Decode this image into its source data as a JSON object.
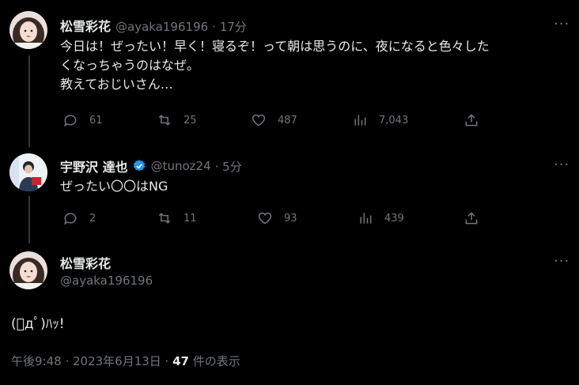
{
  "tweet1": {
    "name": "松雪彩花",
    "handle": "@ayaka196196",
    "time": "· 17分",
    "lines": [
      "今日は！ぜったい！早く！寝るぞ！って朝は思うのに、夜になると色々した",
      "くなっちゃうのはなぜ。",
      "教えておじいさん…"
    ],
    "replies": "61",
    "retweets": "25",
    "likes": "487",
    "views": "7,043"
  },
  "tweet2": {
    "name": "宇野沢 達也",
    "handle": "@tunoz24",
    "time": "· 5分",
    "text": "ぜったい〇〇はNG",
    "replies": "2",
    "retweets": "11",
    "likes": "93",
    "views": "439"
  },
  "tweet3": {
    "name": "松雪彩花",
    "handle": "@ayaka196196",
    "text": "(ﾟдﾟ)ﾊｯ!",
    "time": "午後9:48 · 2023年6月13日 ·",
    "view_count": "47",
    "view_suffix": "件の表示"
  },
  "colors": {
    "background": "#000000",
    "text": "#e7e9ea",
    "muted": "#71767b",
    "verified": "#1d9bf0"
  }
}
